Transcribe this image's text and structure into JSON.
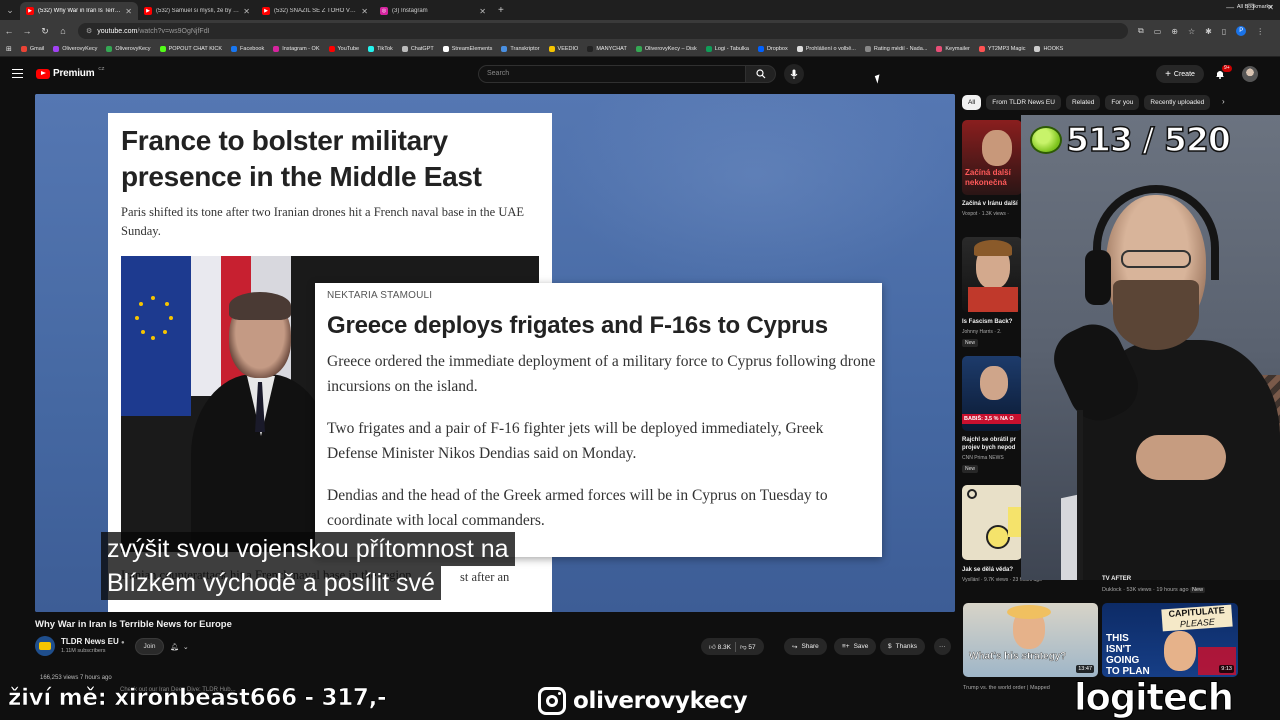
{
  "browser": {
    "tabs": [
      {
        "title": "(532) Why War in Iran Is Terrible",
        "favicon_color": "#ff0000",
        "active": true
      },
      {
        "title": "(532) Samuel si myslí, že by Erik",
        "favicon_color": "#ff0000",
        "active": false
      },
      {
        "title": "(532) SNAŽIL SE Z TOHO VYBR",
        "favicon_color": "#ff0000",
        "active": false
      },
      {
        "title": "(3) Instagram",
        "favicon_color": "#d6249f",
        "active": false
      }
    ],
    "url_host": "youtube.com",
    "url_path": "/watch?v=ws9OgNjfFdI",
    "bookmarks": [
      {
        "label": "Gmail",
        "color": "#ea4335"
      },
      {
        "label": "OliverovyKecy",
        "color": "#a142f4"
      },
      {
        "label": "OliverovyKecy",
        "color": "#34a853"
      },
      {
        "label": "POPOUT CHAT KICK",
        "color": "#53fc18"
      },
      {
        "label": "Facebook",
        "color": "#1877f2"
      },
      {
        "label": "Instagram - OK",
        "color": "#d6249f"
      },
      {
        "label": "YouTube",
        "color": "#ff0000"
      },
      {
        "label": "TikTok",
        "color": "#25f4ee"
      },
      {
        "label": "ChatGPT",
        "color": "#bbbbbb"
      },
      {
        "label": "StreamElements",
        "color": "#ffffff"
      },
      {
        "label": "Transkriptor",
        "color": "#4a90e2"
      },
      {
        "label": "VEEDIO",
        "color": "#f5c400"
      },
      {
        "label": "MANYCHAT",
        "color": "#222222"
      },
      {
        "label": "OliverovyKecy – Disk",
        "color": "#34a853"
      },
      {
        "label": "Logi - Tabulka",
        "color": "#0f9d58"
      },
      {
        "label": "Dropbox",
        "color": "#0061ff"
      },
      {
        "label": "Prohlášení o volbě...",
        "color": "#dddddd"
      },
      {
        "label": "Rating médií - Nada...",
        "color": "#888888"
      },
      {
        "label": "Keymailer",
        "color": "#e94e77"
      },
      {
        "label": "YT2MP3 Magic",
        "color": "#ff5252"
      },
      {
        "label": "HOOKS",
        "color": "#cccccc"
      }
    ],
    "all_bookmarks": "All Bookmarks"
  },
  "youtube": {
    "logo_word": "Premium",
    "logo_sup": "CZ",
    "search_placeholder": "Search",
    "create_label": "Create",
    "bell_badge": "9+"
  },
  "video": {
    "article1": {
      "title": "France to bolster military presence in the Middle East",
      "subtitle": "Paris shifted its tone after two Iranian drones hit a French naval base in the UAE Sunday.",
      "bottom_text": "Iranian counterattack hit a French naval base in the region"
    },
    "article2": {
      "byline": "NEKTARIA STAMOULI",
      "title": "Greece deploys frigates and F-16s to Cyprus",
      "p1": "Greece ordered the immediate deployment of a military force to Cyprus following drone incursions on the island.",
      "p2": "Two frigates and a pair of F-16 fighter jets will be deployed immediately, Greek Defense Minister Nikos Dendias said on Monday.",
      "p3": "Dendias and the head of the Greek armed forces will be in Cyprus on Tuesday to coordinate with local commanders."
    },
    "caption_line1": "zvýšit svou vojenskou přítomnost na",
    "caption_line2": "Blízkém východě a posílit své",
    "caption_tail": "st after an",
    "title": "Why War in Iran Is Terrible News for Europe",
    "channel": "TLDR News EU",
    "subscribers": "1.11M subscribers",
    "join_label": "Join",
    "likes": "8.3K",
    "dislikes": "57",
    "share_label": "Share",
    "save_label": "Save",
    "thanks_label": "Thanks",
    "views_line": "166,253 views  7 hours ago",
    "desc_fragment": "Check out our Iran Deep Dive: TLDR Hub..."
  },
  "sidebar": {
    "chips": [
      "All",
      "From TLDR News EU",
      "Related",
      "For you",
      "Recently uploaded"
    ],
    "recs": [
      {
        "thumb_text": "Začíná další nekonečná",
        "title": "Začíná v Íránu další",
        "meta": "Voxpot · 1.3K views ·"
      },
      {
        "title": "Is Fascism Back?",
        "meta": "Johnny Harris · 2.",
        "badge": "New"
      },
      {
        "thumb_text": "BABIŠ: 3,5 % NA O",
        "title": "Rajchl se obrátil pr",
        "title2": "projev bych nepod",
        "meta": "CNN Prima NEWS",
        "badge": "New"
      },
      {
        "title": "Jak se dělá věda?",
        "meta": "Vysílání · 9.7K views · 23 hours ago"
      }
    ],
    "bottom_recs": [
      {
        "thumb_text": "What's his strategy?",
        "meta": "Trump vs. the world order | Mapped"
      },
      {
        "thumb_text1": "CAPITULATE",
        "thumb_text2": "PLEASE",
        "thumb_text3": "THIS ISN'T GOING TO PLAN",
        "meta": "Duklock · 53K views · 19 hours ago",
        "badge": "New",
        "duration": "9:13"
      }
    ],
    "partial_title": "TV AFTER",
    "duration1": "13:47"
  },
  "stream_overlay": {
    "counter": "513 / 520",
    "left_text": "živí mě: xironbeast666 - 317,-",
    "instagram_handle": "oliverovykecy",
    "sponsor": "logitech"
  }
}
